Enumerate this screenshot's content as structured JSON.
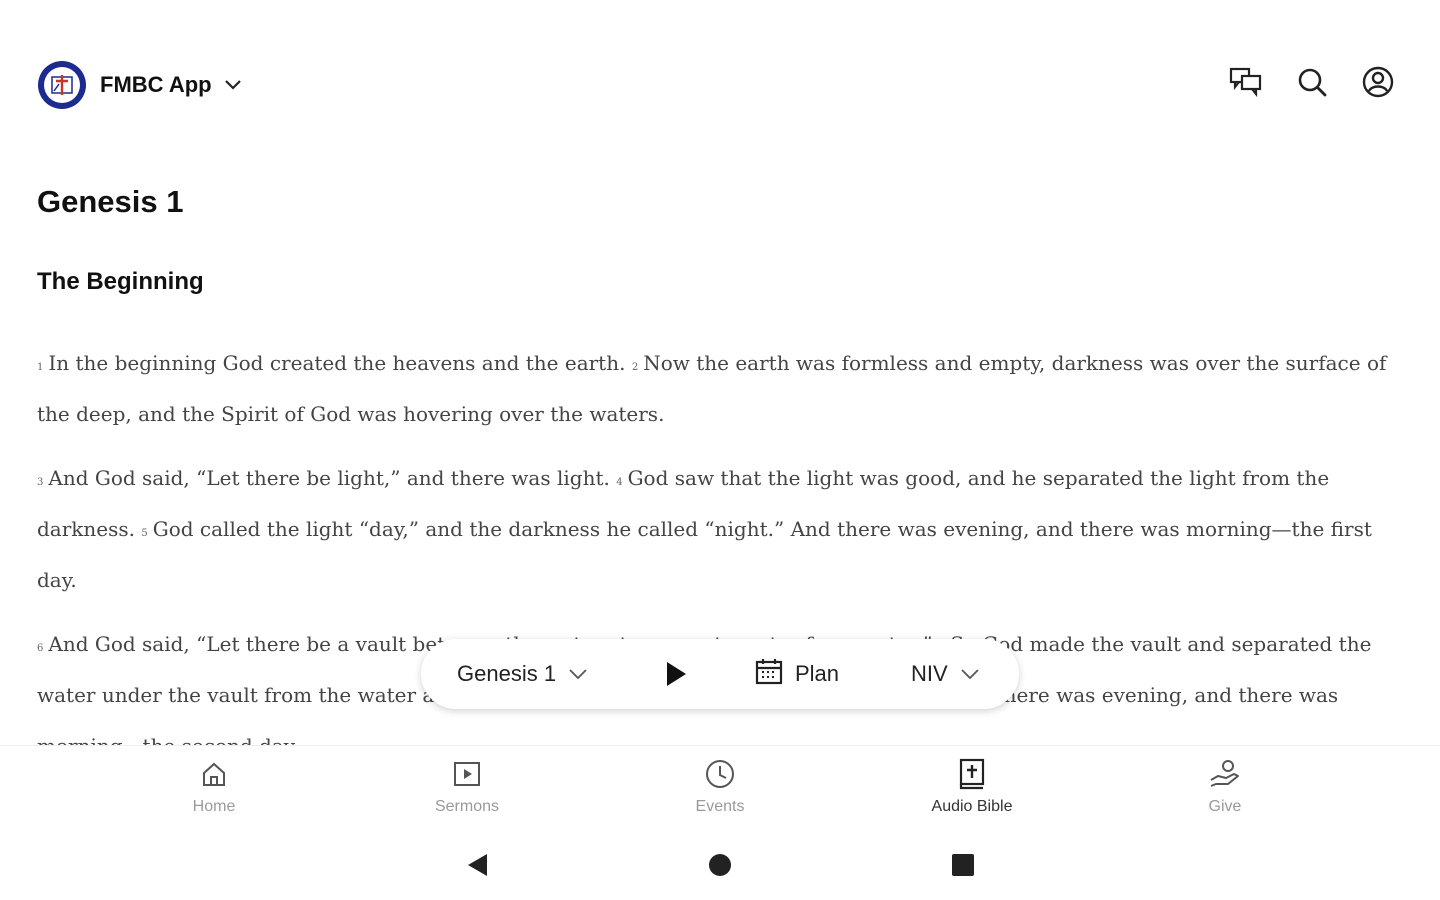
{
  "header": {
    "app_name": "FMBC App"
  },
  "icons": {
    "logo": "church-logo-icon",
    "app_menu": "chevron-down-icon",
    "chat": "chat-icon",
    "search": "search-icon",
    "account": "account-icon"
  },
  "bible": {
    "chapter_title": "Genesis 1",
    "section_title": "The Beginning",
    "paragraphs": [
      {
        "verses": [
          {
            "num": "1",
            "text": "In the beginning God created the heavens and the earth."
          },
          {
            "num": "2",
            "text": "Now the earth was formless and empty, darkness was over the surface of the deep, and the Spirit of God was hovering over the waters."
          }
        ]
      },
      {
        "verses": [
          {
            "num": "3",
            "text": "And God said, “Let there be light,” and there was light."
          },
          {
            "num": "4",
            "text": "God saw that the light was good, and he separated the light from the darkness."
          },
          {
            "num": "5",
            "text": "God called the light “day,” and the darkness he called “night.” And there was evening, and there was morning—the first day."
          }
        ]
      },
      {
        "verses": [
          {
            "num": "6",
            "text": "And God said, “Let there be a vault between the waters to separate water from water.”"
          },
          {
            "num": "7",
            "text": "So God made the vault and separated the water under the vault from the water above it. And it was so."
          },
          {
            "num": "8",
            "text": "God called the vault “sky.” And there was evening, and there was morning—the second day."
          }
        ]
      }
    ]
  },
  "player": {
    "chapter_label": "Genesis 1",
    "plan_label": "Plan",
    "version_label": "NIV"
  },
  "nav": {
    "items": [
      {
        "label": "Home",
        "icon": "home-icon"
      },
      {
        "label": "Sermons",
        "icon": "play-square-icon"
      },
      {
        "label": "Events",
        "icon": "clock-icon"
      },
      {
        "label": "Audio Bible",
        "icon": "book-plus-icon",
        "active": true
      },
      {
        "label": "Give",
        "icon": "give-icon"
      }
    ]
  },
  "system_nav": {
    "back": "back-triangle-icon",
    "home": "home-circle-icon",
    "recents": "recents-square-icon"
  },
  "colors": {
    "logo_blue": "#1d2a8f",
    "text_dark": "#111111",
    "verse_text": "#444444",
    "nav_inactive": "#9a9a9a"
  }
}
